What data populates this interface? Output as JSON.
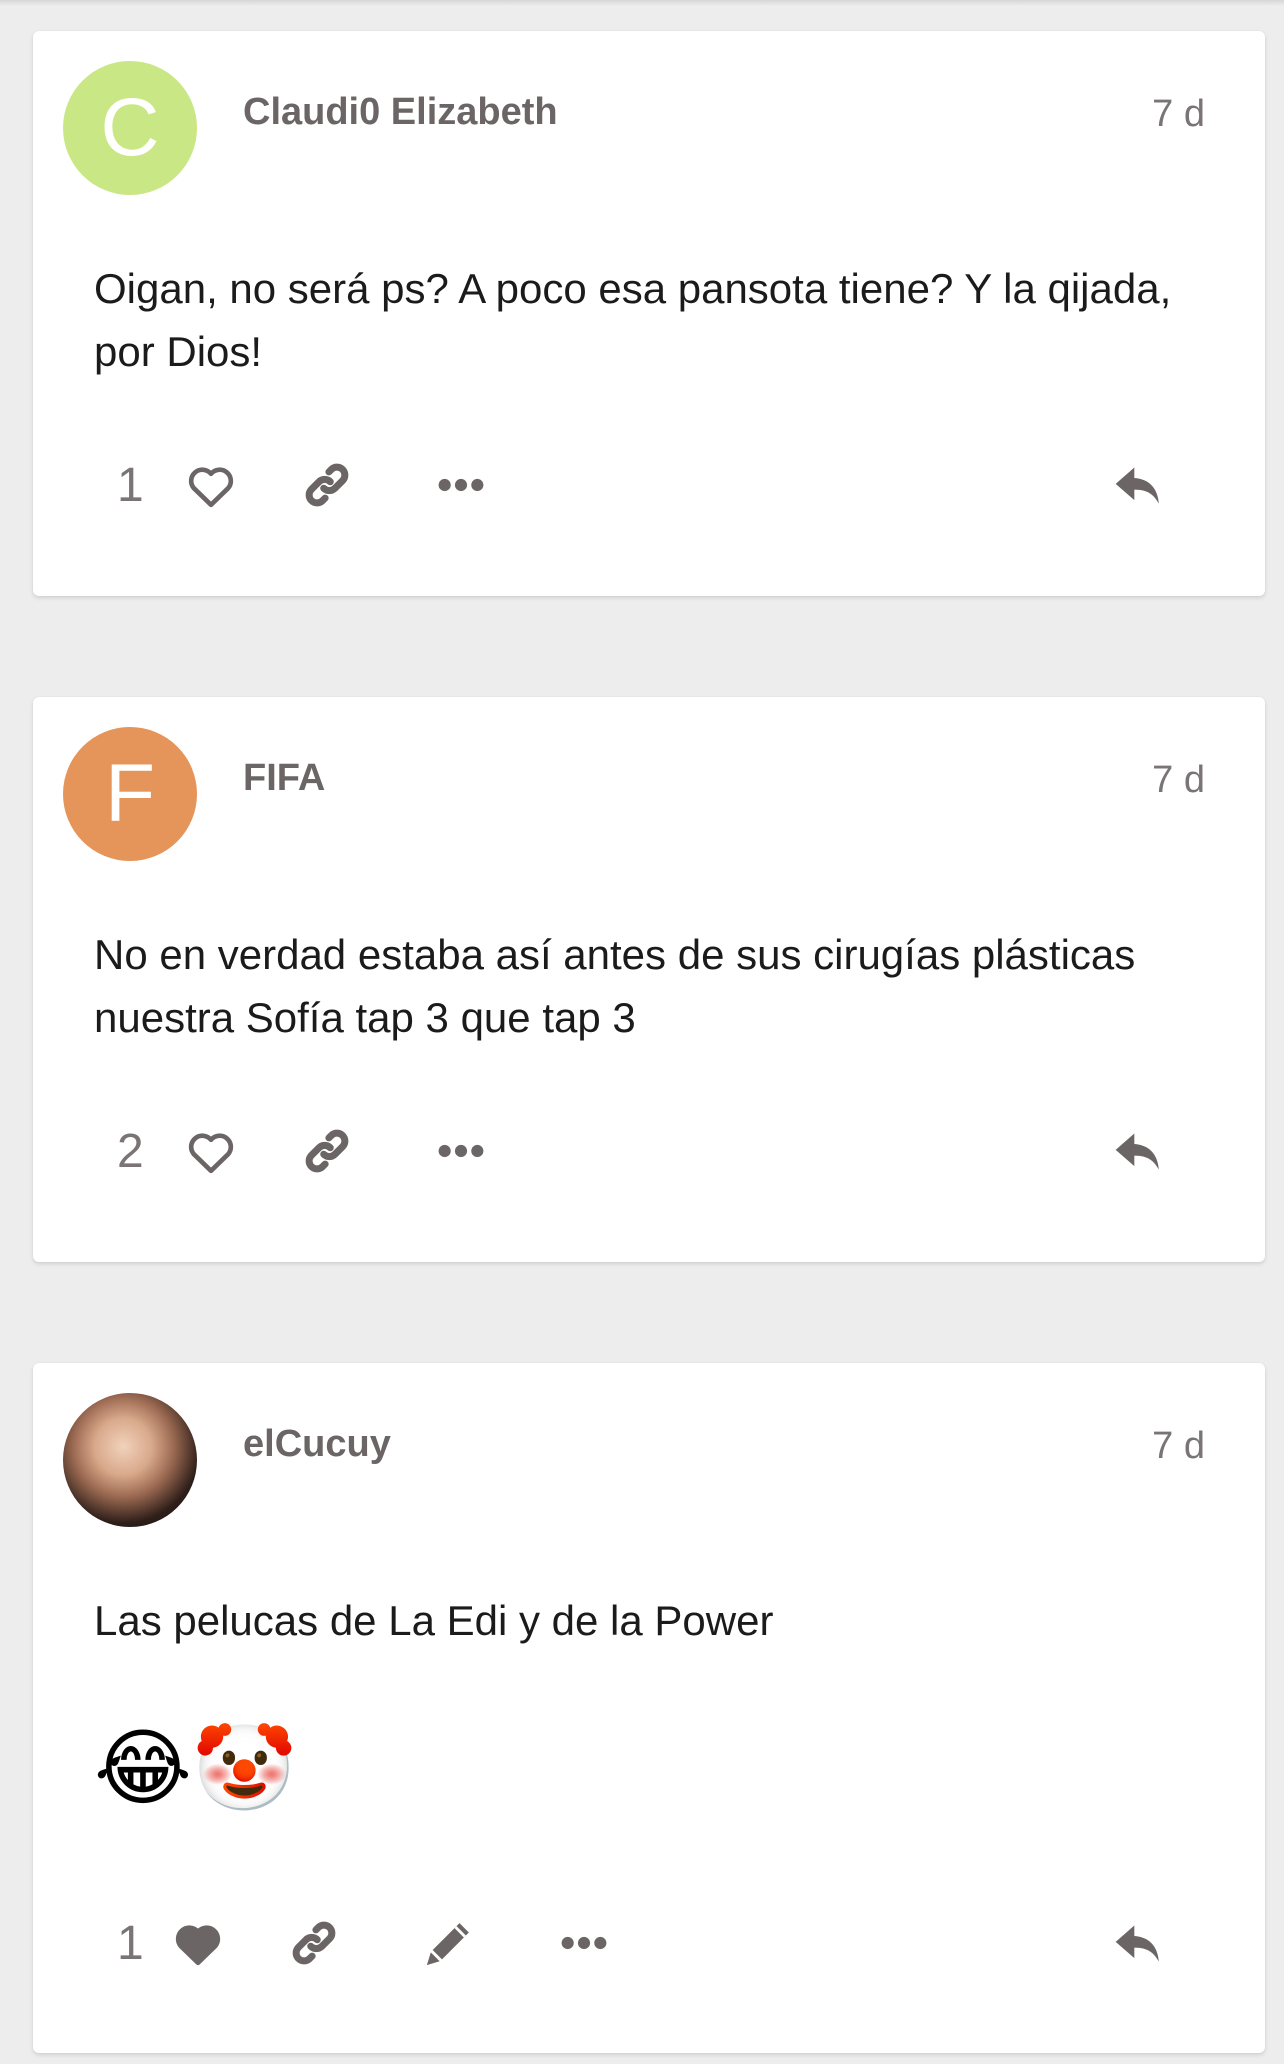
{
  "posts": [
    {
      "avatar_letter": "C",
      "avatar_color": "#c9e785",
      "username": "Claudi0 Elizabeth",
      "time": "7 d",
      "text": "Oigan, no será ps? A poco esa pansota tiene? Y la qijada, por Dios!",
      "likes": "1",
      "liked": false,
      "icons": [
        "heart-outline-icon",
        "link-icon",
        "more-icon",
        "reply-icon"
      ]
    },
    {
      "avatar_letter": "F",
      "avatar_color": "#e59559",
      "username": "FIFA",
      "time": "7 d",
      "text": "No en verdad estaba así antes de sus cirugías plásticas nuestra Sofía tap 3 que tap 3",
      "likes": "2",
      "liked": false,
      "icons": [
        "heart-outline-icon",
        "link-icon",
        "more-icon",
        "reply-icon"
      ]
    },
    {
      "avatar_letter": "",
      "username": "elCucuy",
      "time": "7 d",
      "text": "Las pelucas de La Edi y de la Power",
      "emojis": "😂🤡",
      "likes": "1",
      "liked": true,
      "icons": [
        "heart-filled-icon",
        "link-icon",
        "pencil-icon",
        "more-icon",
        "reply-icon"
      ]
    }
  ],
  "colors": {
    "icon": "#6b6566",
    "card": "#ffffff",
    "background": "#ededed"
  }
}
